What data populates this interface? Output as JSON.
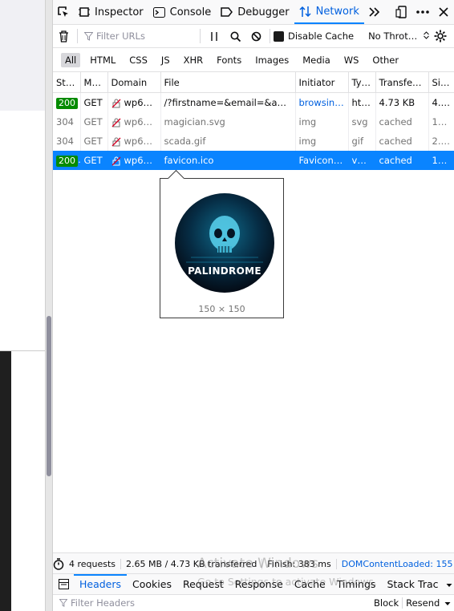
{
  "toolbar": {
    "inspector": "Inspector",
    "console": "Console",
    "debugger": "Debugger",
    "network": "Network"
  },
  "filterbar": {
    "filter_placeholder": "Filter URLs",
    "disable_cache": "Disable Cache",
    "throttle": "No Throt…"
  },
  "type_filters": [
    "All",
    "HTML",
    "CSS",
    "JS",
    "XHR",
    "Fonts",
    "Images",
    "Media",
    "WS",
    "Other"
  ],
  "columns": [
    "Sta…",
    "Me…",
    "Domain",
    "File",
    "Initiator",
    "Ty…",
    "Transferr…",
    "Size"
  ],
  "requests": [
    {
      "status": "200",
      "method": "GET",
      "domain": "wp6p…",
      "file": "/?firstname=&email=&addres…",
      "initiator": "browsing…",
      "type": "html",
      "transferred": "4.73 KB",
      "size": "4.…"
    },
    {
      "status": "304",
      "method": "GET",
      "domain": "wp6p…",
      "file": "magician.svg",
      "initiator": "img",
      "type": "svg",
      "transferred": "cached",
      "size": "13…"
    },
    {
      "status": "304",
      "method": "GET",
      "domain": "wp6p…",
      "file": "scada.gif",
      "initiator": "img",
      "type": "gif",
      "transferred": "cached",
      "size": "2.5…"
    },
    {
      "status": "200",
      "method": "GET",
      "domain": "wp6p…",
      "file": "favicon.ico",
      "initiator": "FaviconL…",
      "type": "vn…",
      "transferred": "cached",
      "size": "12 …"
    }
  ],
  "tooltip": {
    "logo_text": "PALINDROME",
    "dimensions": "150 × 150"
  },
  "statusbar": {
    "requests": "4 requests",
    "transferred": "2.65 MB / 4.73 KB transferred",
    "finish": "Finish: 383 ms",
    "dom_loaded": "DOMContentLoaded: 155"
  },
  "panel_tabs": [
    "Headers",
    "Cookies",
    "Request",
    "Response",
    "Cache",
    "Timings",
    "Stack Trac"
  ],
  "details_filter": {
    "placeholder": "Filter Headers",
    "block": "Block",
    "resend": "Resend"
  },
  "watermark": {
    "line1": "Activate Windows",
    "line2": "Go to Settings to activate Windows."
  }
}
